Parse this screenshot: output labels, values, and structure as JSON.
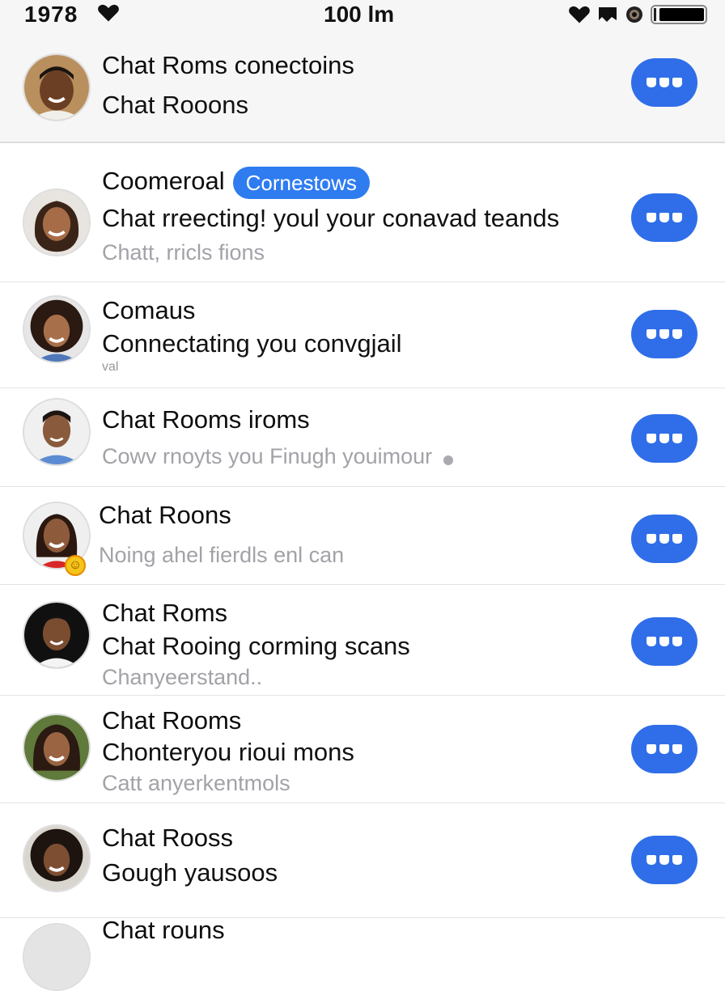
{
  "status_bar": {
    "left_text": "1978",
    "center_text": "100 lm"
  },
  "chats": [
    {
      "title": "Chat Roms conectoins",
      "preview": "Chat Rooons",
      "muted": ""
    },
    {
      "title": "Coomeroal",
      "badge": "Cornestows",
      "preview": "Chat rreecting! youl your conavad teands",
      "muted": "Chatt, rricls fions"
    },
    {
      "title": "Comaus",
      "preview": "Connectating you convgjail",
      "muted": "",
      "tiny": "val"
    },
    {
      "title": "Chat Rooms iroms",
      "preview": "",
      "muted": "Cowv rnoyts you Finugh youimour"
    },
    {
      "title": "Chat Roons",
      "preview": "",
      "muted": "Noing ahel fierdls enl can"
    },
    {
      "title": "Chat Roms",
      "preview": "Chat Rooing corming scans",
      "muted": "Chanyeerstand.."
    },
    {
      "title": "Chat Rooms",
      "preview": "Chonteryou rioui mons",
      "muted": "Catt anyerkentmols"
    },
    {
      "title": "Chat Rooss",
      "preview": "Gough yausoos",
      "muted": ""
    },
    {
      "title": "Chat rouns",
      "preview": "",
      "muted": ""
    }
  ],
  "icons": {
    "heart": "heart-icon",
    "more": "more-icon",
    "battery": "battery-icon"
  },
  "colors": {
    "accent": "#2f6ee8",
    "badge": "#2f7cf0",
    "muted_text": "#a2a2a8"
  }
}
